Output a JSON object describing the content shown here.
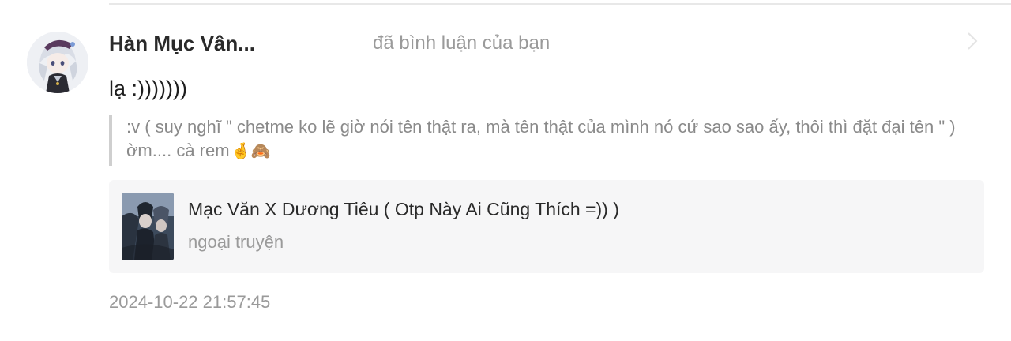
{
  "notification": {
    "user_name": "Hàn Mục Vân...",
    "action_text": "đã bình luận của bạn",
    "reply_text": "lạ :)))))))",
    "quoted_comment": ":v ( suy nghĩ \" chetme ko lẽ giờ nói tên thật ra, mà tên thật của mình nó cứ sao sao ấy, thôi thì đặt đại tên \" ) ờm.... cà rem",
    "quoted_emojis": "🤞🙈",
    "work": {
      "title": "Mạc Văn X Dương Tiêu ( Otp Này Ai Cũng Thích =)) )",
      "subtitle": "ngoại truyện"
    },
    "timestamp": "2024-10-22 21:57:45"
  },
  "colors": {
    "text_primary": "#2a2a2a",
    "text_secondary": "#9a9a9a",
    "quote_border": "#cfcfcf",
    "card_background": "#f6f6f7"
  },
  "icons": {
    "avatar": "user-avatar-anime-character",
    "chevron": "chevron-right-icon",
    "cover": "story-cover-thumbnail"
  }
}
